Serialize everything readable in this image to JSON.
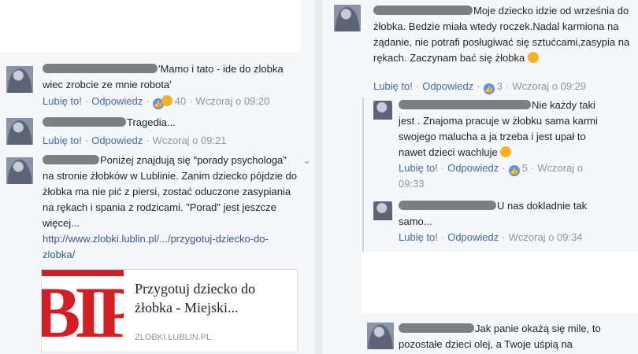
{
  "left": {
    "comments": [
      {
        "text": "'Mamo i tato - ide do zlobka wiec zrobcie ze mnie robota'",
        "like": "Lubię to!",
        "reply": "Odpowiedz",
        "count": "40",
        "time": "Wczoraj o 09:20"
      },
      {
        "text": "Tragedia...",
        "like": "Lubię to!",
        "reply": "Odpowiedz",
        "time": "Wczoraj o 09:21"
      },
      {
        "text": "Poniżej znajdują się \"porady psychologa\" na stronie żłobków w Lublinie. Zanim dziecko pójdzie do żłobka ma nie pić z piersi, zostać oduczone zasypiania na rękach i spania z rodzicami. \"Porad\" jest jeszcze więcej...",
        "link": "http://www.zlobki.lublin.pl/.../przygotuj-dziecko-do-zlobka/"
      }
    ],
    "card": {
      "title": "Przygotuj dziecko do żłobka - Miejski...",
      "domain": "ZLOBKI.LUBLIN.PL",
      "logo": "BIP"
    },
    "chevron": "⌄"
  },
  "right": {
    "comments": [
      {
        "text": "Moje dziecko idzie od września do żłobka. Bedzie miała wtedy roczek.Nadal karmiona na żądanie, nie potrafi posługiwać się sztućcami,zasypia na rękach. Zaczynam bać się żłobka",
        "like": "Lubię to!",
        "reply": "Odpowiedz",
        "count": "3",
        "time": "Wczoraj o 09:29"
      },
      {
        "text": "Nie każdy taki jest . Znajoma pracuje w żłobku sama karmi swojego malucha a ja trzeba i jest upał to nawet dzieci wachluje",
        "like": "Lubię to!",
        "reply": "Odpowiedz",
        "count": "5",
        "time1": "Wczoraj o",
        "time2": "09:33"
      },
      {
        "text": "U nas dokladnie tak samo...",
        "like": "Lubię to!",
        "reply": "Odpowiedz",
        "time": "Wczoraj o 09:34"
      },
      {
        "text": "Jak panie okażą się mile, to pozostałe dzieci olej, a Twoje uśpią na"
      }
    ]
  },
  "colors": {
    "link": "#365899",
    "action": "#4267b2",
    "meta": "#90949c",
    "like": "#5890ff",
    "haha": "#f7b125",
    "bip_red": "#d11f25"
  },
  "icons": [
    "like-reaction-icon",
    "haha-reaction-icon",
    "worried-emoji-icon",
    "wink-emoji-icon",
    "chevron-down-icon",
    "bip-logo"
  ]
}
